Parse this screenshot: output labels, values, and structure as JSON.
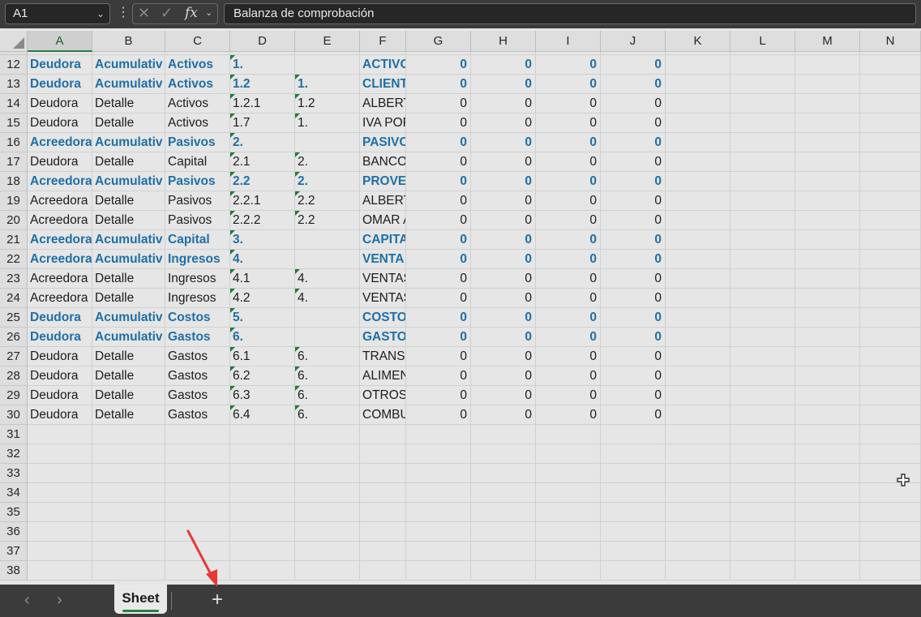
{
  "formula_bar": {
    "name_box": "A1",
    "formula": "Balanza de comprobación",
    "fx_label": "fx"
  },
  "columns": [
    "A",
    "B",
    "C",
    "D",
    "E",
    "F",
    "G",
    "H",
    "I",
    "J",
    "K",
    "L",
    "M",
    "N"
  ],
  "top_partial_row": "11",
  "top_partial_cells": [
    "",
    "",
    "",
    "",
    "",
    "",
    "",
    "",
    "",
    ""
  ],
  "rows": [
    {
      "n": "12",
      "hl": true,
      "cells": [
        "Deudora",
        "Acumulativ",
        "Activos",
        "1.",
        "",
        "ACTIVO",
        "0",
        "0",
        "0",
        "0"
      ]
    },
    {
      "n": "13",
      "hl": true,
      "cells": [
        "Deudora",
        "Acumulativ",
        "Activos",
        "1.2",
        "1.",
        "CLIENT",
        "0",
        "0",
        "0",
        "0"
      ]
    },
    {
      "n": "14",
      "hl": false,
      "cells": [
        "Deudora",
        "Detalle",
        "Activos",
        "1.2.1",
        "1.2",
        "ALBERT",
        "0",
        "0",
        "0",
        "0"
      ]
    },
    {
      "n": "15",
      "hl": false,
      "cells": [
        "Deudora",
        "Detalle",
        "Activos",
        "1.7",
        "1.",
        "IVA POR",
        "0",
        "0",
        "0",
        "0"
      ]
    },
    {
      "n": "16",
      "hl": true,
      "cells": [
        "Acreedora",
        "Acumulativ",
        "Pasivos",
        "2.",
        "",
        "PASIVO",
        "0",
        "0",
        "0",
        "0"
      ]
    },
    {
      "n": "17",
      "hl": false,
      "cells": [
        "Deudora",
        "Detalle",
        "Capital",
        "2.1",
        "2.",
        "BANCO",
        "0",
        "0",
        "0",
        "0"
      ]
    },
    {
      "n": "18",
      "hl": true,
      "cells": [
        "Acreedora",
        "Acumulativ",
        "Pasivos",
        "2.2",
        "2.",
        "PROVE",
        "0",
        "0",
        "0",
        "0"
      ]
    },
    {
      "n": "19",
      "hl": false,
      "cells": [
        "Acreedora",
        "Detalle",
        "Pasivos",
        "2.2.1",
        "2.2",
        "ALBERT",
        "0",
        "0",
        "0",
        "0"
      ]
    },
    {
      "n": "20",
      "hl": false,
      "cells": [
        "Acreedora",
        "Detalle",
        "Pasivos",
        "2.2.2",
        "2.2",
        "OMAR A",
        "0",
        "0",
        "0",
        "0"
      ]
    },
    {
      "n": "21",
      "hl": true,
      "cells": [
        "Acreedora",
        "Acumulativ",
        "Capital",
        "3.",
        "",
        "CAPITA",
        "0",
        "0",
        "0",
        "0"
      ]
    },
    {
      "n": "22",
      "hl": true,
      "cells": [
        "Acreedora",
        "Acumulativ",
        "Ingresos",
        "4.",
        "",
        "VENTA",
        "0",
        "0",
        "0",
        "0"
      ]
    },
    {
      "n": "23",
      "hl": false,
      "cells": [
        "Acreedora",
        "Detalle",
        "Ingresos",
        "4.1",
        "4.",
        "VENTAS",
        "0",
        "0",
        "0",
        "0"
      ]
    },
    {
      "n": "24",
      "hl": false,
      "cells": [
        "Acreedora",
        "Detalle",
        "Ingresos",
        "4.2",
        "4.",
        "VENTAS",
        "0",
        "0",
        "0",
        "0"
      ]
    },
    {
      "n": "25",
      "hl": true,
      "cells": [
        "Deudora",
        "Acumulativ",
        "Costos",
        "5.",
        "",
        "COSTO",
        "0",
        "0",
        "0",
        "0"
      ]
    },
    {
      "n": "26",
      "hl": true,
      "cells": [
        "Deudora",
        "Acumulativ",
        "Gastos",
        "6.",
        "",
        "GASTO",
        "0",
        "0",
        "0",
        "0"
      ]
    },
    {
      "n": "27",
      "hl": false,
      "cells": [
        "Deudora",
        "Detalle",
        "Gastos",
        "6.1",
        "6.",
        "TRANSP",
        "0",
        "0",
        "0",
        "0"
      ]
    },
    {
      "n": "28",
      "hl": false,
      "cells": [
        "Deudora",
        "Detalle",
        "Gastos",
        "6.2",
        "6.",
        "ALIMEN",
        "0",
        "0",
        "0",
        "0"
      ]
    },
    {
      "n": "29",
      "hl": false,
      "cells": [
        "Deudora",
        "Detalle",
        "Gastos",
        "6.3",
        "6.",
        "OTROS",
        "0",
        "0",
        "0",
        "0"
      ]
    },
    {
      "n": "30",
      "hl": false,
      "cells": [
        "Deudora",
        "Detalle",
        "Gastos",
        "6.4",
        "6.",
        "COMBU",
        "0",
        "0",
        "0",
        "0"
      ]
    }
  ],
  "empty_rows": [
    "31",
    "32",
    "33",
    "34",
    "35",
    "36",
    "37",
    "38"
  ],
  "sheet_tabs": [
    {
      "label": "Sheet",
      "active": true
    }
  ],
  "add_sheet_label": "+",
  "colors": {
    "accent_text": "#1f6fa7",
    "selection": "#2f7d45",
    "annotation_arrow": "#e53935"
  }
}
